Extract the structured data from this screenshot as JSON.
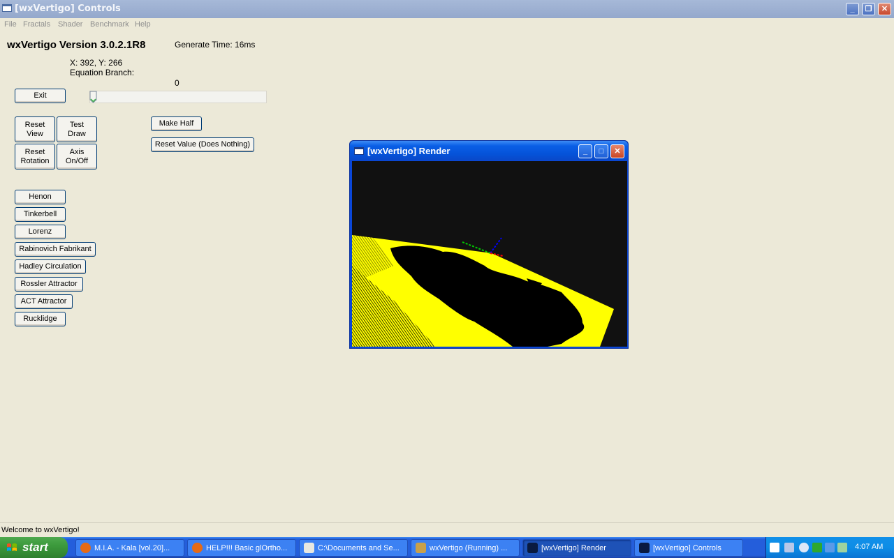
{
  "window": {
    "title": "[wxVertigo] Controls",
    "minimize_glyph": "_",
    "restore_glyph": "❐",
    "close_glyph": "✕"
  },
  "menu": [
    "File",
    "Fractals",
    "Shader",
    "Benchmark",
    "Help"
  ],
  "header": {
    "version": "wxVertigo Version 3.0.2.1R8",
    "generate_time": "Generate Time: 16ms",
    "coords": "X: 392, Y: 266",
    "equation_branch": "Equation Branch:",
    "slider_value": "0"
  },
  "buttons": {
    "exit": "Exit",
    "reset_view": "Reset\nView",
    "test_draw": "Test\nDraw",
    "reset_rotation": "Reset\nRotation",
    "axis_toggle": "Axis\nOn/Off",
    "make_half": "Make Half",
    "reset_value": "Reset Value (Does Nothing)"
  },
  "fractals": [
    "Henon",
    "Tinkerbell",
    "Lorenz",
    "Rabinovich Fabrikant",
    "Hadley Circulation",
    "Rossler Attractor",
    "ACT Attractor",
    "Rucklidge"
  ],
  "render_window": {
    "title": "[wxVertigo] Render",
    "minimize_glyph": "_",
    "maximize_glyph": "□",
    "close_glyph": "✕"
  },
  "status": "Welcome to wxVertigo!",
  "taskbar": {
    "start": "start",
    "tasks": [
      {
        "label": "M.I.A. - Kala [vol.20]...",
        "icon": "firefox-icon"
      },
      {
        "label": "HELP!!! Basic glOrtho...",
        "icon": "firefox-icon"
      },
      {
        "label": "C:\\Documents and Se...",
        "icon": "notepad-icon"
      },
      {
        "label": "wxVertigo (Running) ...",
        "icon": "debugger-icon"
      },
      {
        "label": "[wxVertigo] Render",
        "icon": "app-icon"
      },
      {
        "label": "[wxVertigo] Controls",
        "icon": "app-icon"
      }
    ],
    "clock": "4:07 AM"
  },
  "colors": {
    "fractal": "#ffff00",
    "canvas_bg": "#111111",
    "axis_x": "#ff0000",
    "axis_y": "#00cc00",
    "axis_z": "#0000ff"
  }
}
